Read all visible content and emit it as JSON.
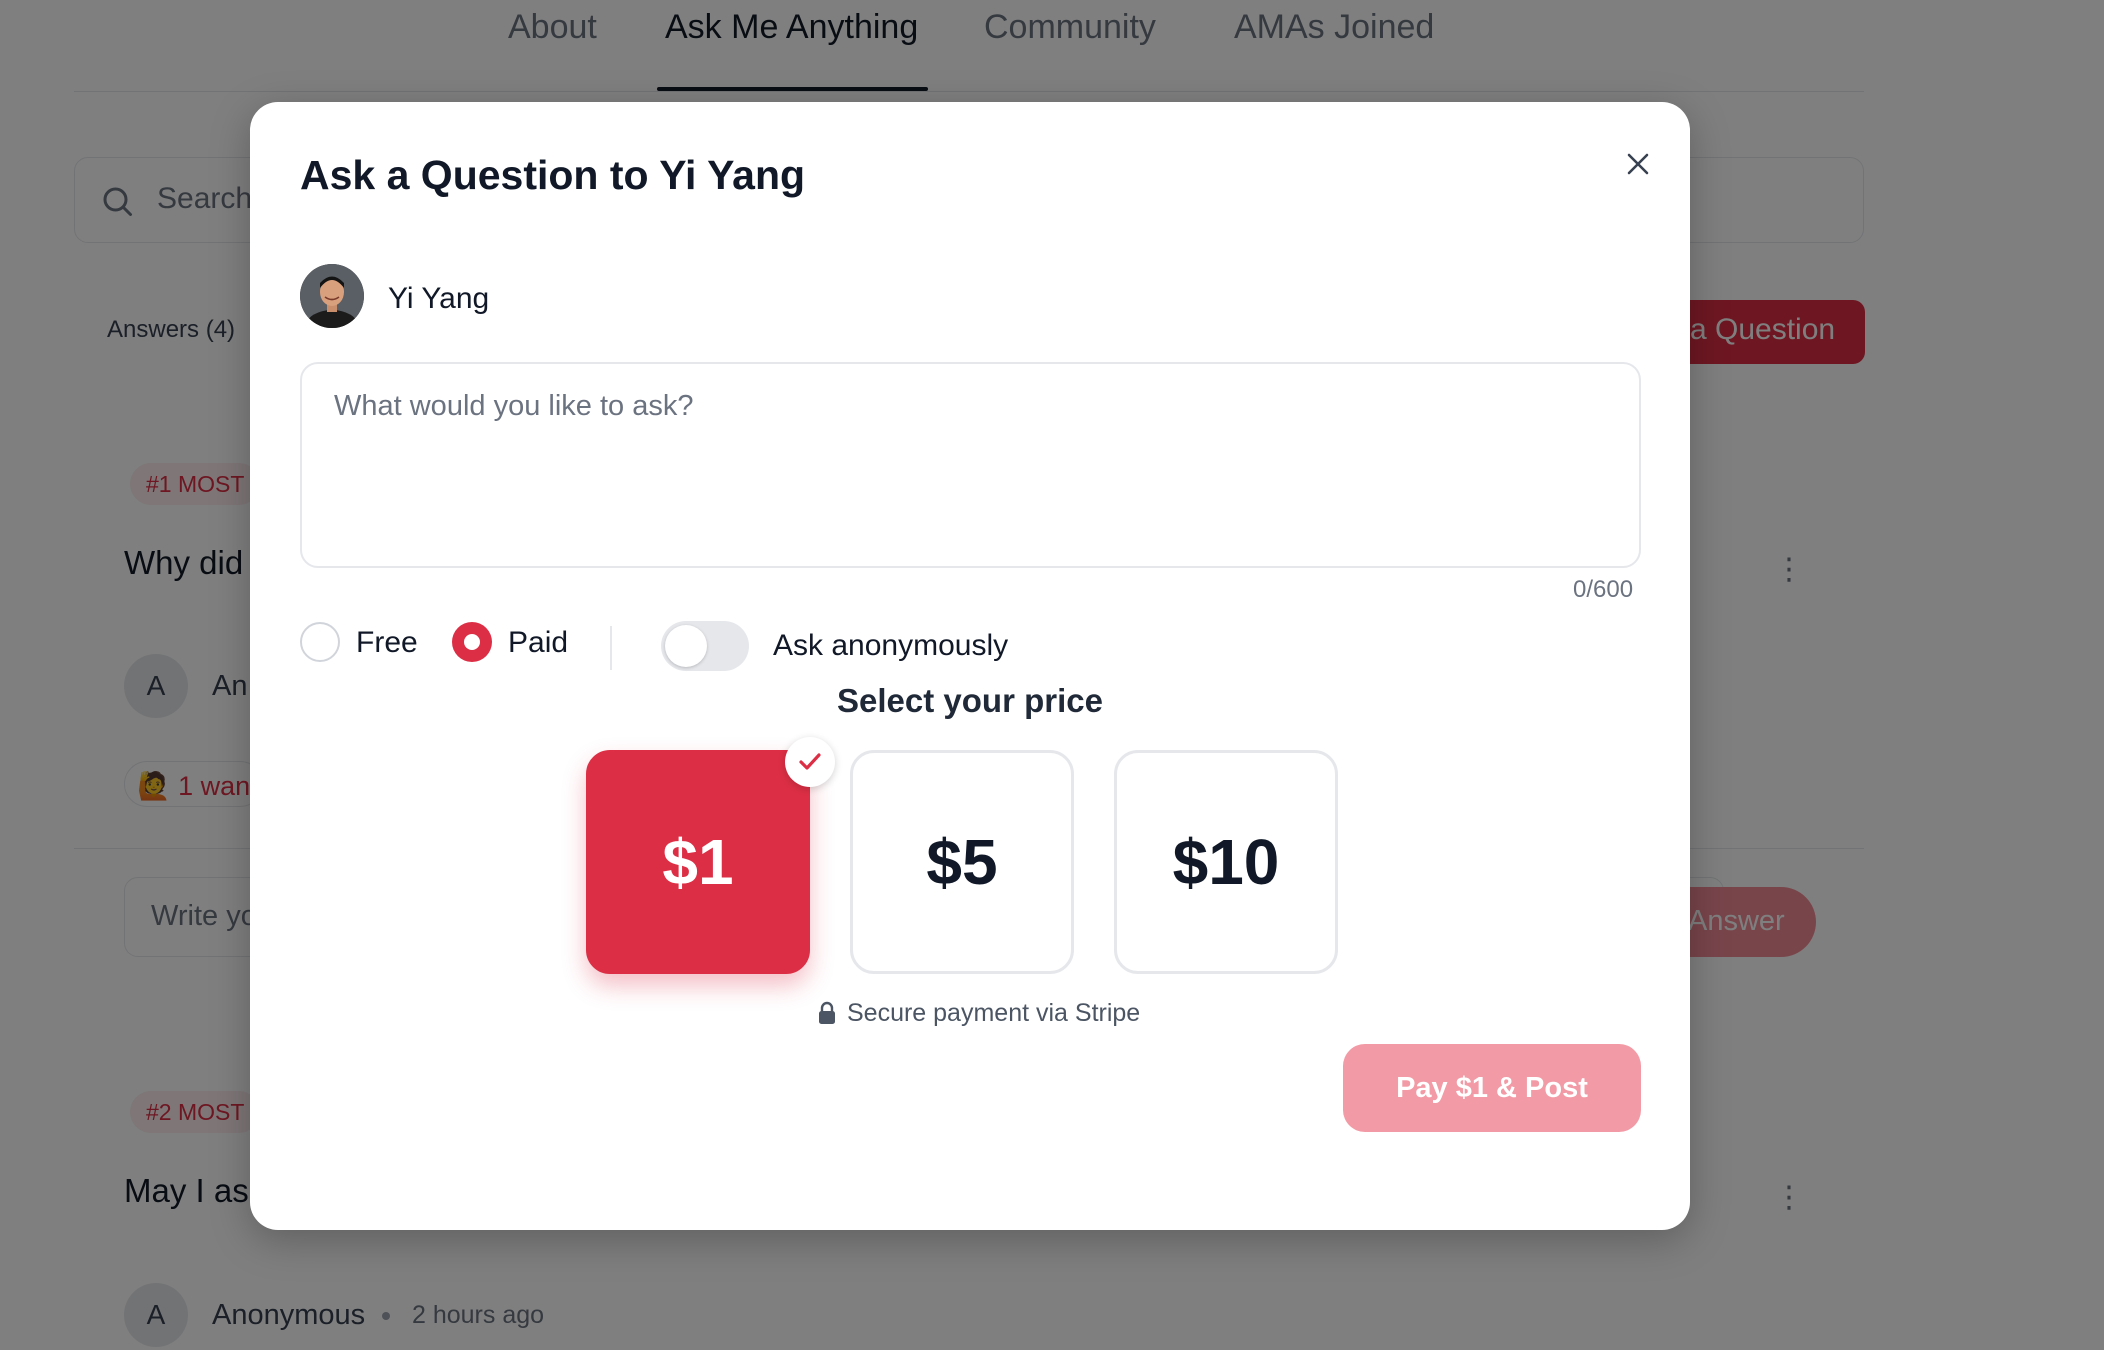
{
  "nav": {
    "tabs": [
      {
        "label": "About"
      },
      {
        "label": "Ask Me Anything"
      },
      {
        "label": "Community"
      },
      {
        "label": "AMAs Joined"
      }
    ],
    "active_tab": "Ask Me Anything"
  },
  "background": {
    "search_placeholder": "Search",
    "answers_label": "Answers (4)",
    "ask_button_label": "a Question",
    "questions": [
      {
        "badge": "#1 MOST",
        "text": "Why did",
        "author_initial": "A",
        "author_name": "An",
        "wants": "1 wan"
      },
      {
        "badge": "#2 MOST",
        "text": "May I asl",
        "author_initial": "A",
        "author_name": "Anonymous",
        "time": "2 hours ago"
      }
    ],
    "write_placeholder": "Write yo",
    "answer_button_label": "Answer"
  },
  "modal": {
    "title": "Ask a Question to Yi Yang",
    "host_name": "Yi Yang",
    "question_placeholder": "What would you like to ask?",
    "char_count": "0/600",
    "options": {
      "free_label": "Free",
      "paid_label": "Paid",
      "selected": "Paid"
    },
    "anonymous_label": "Ask anonymously",
    "anonymous_enabled": false,
    "price_heading": "Select your price",
    "prices": [
      {
        "label": "$1",
        "selected": true
      },
      {
        "label": "$5",
        "selected": false
      },
      {
        "label": "$10",
        "selected": false
      }
    ],
    "secure_note": "Secure payment via Stripe",
    "pay_button_label": "Pay $1 & Post"
  },
  "colors": {
    "accent": "#dc2f45",
    "accent_light": "#f29aa5"
  }
}
